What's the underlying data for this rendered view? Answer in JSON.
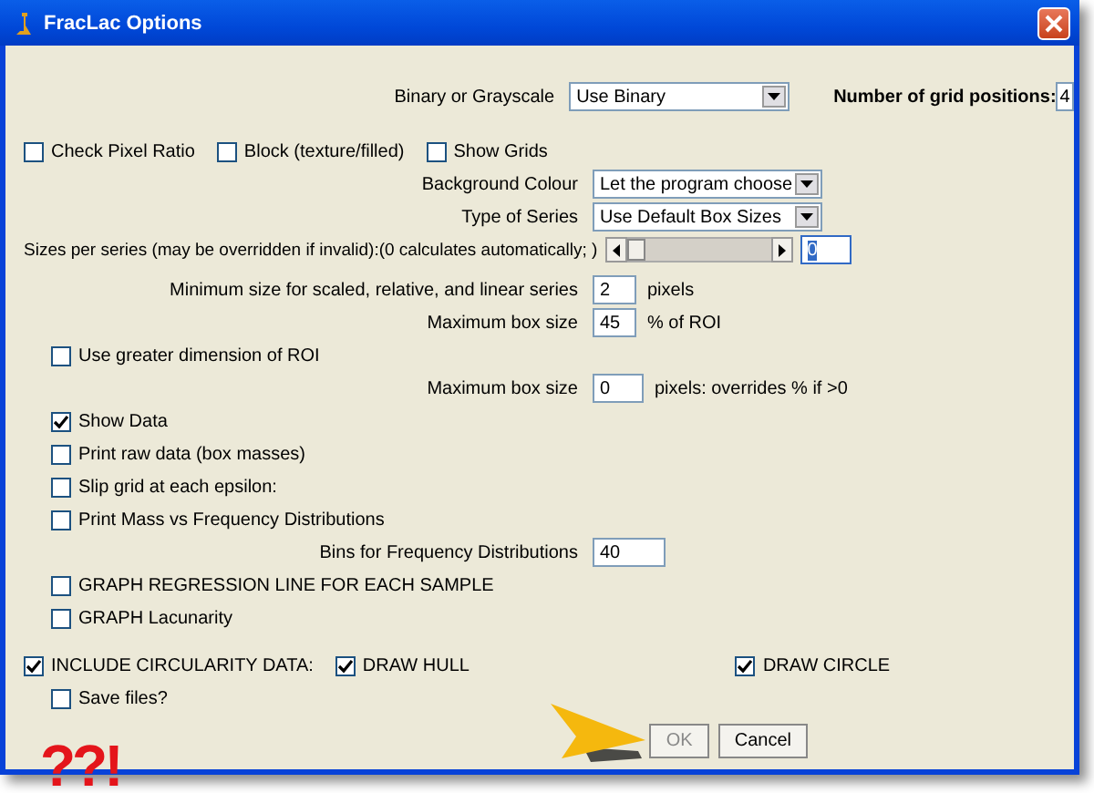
{
  "window": {
    "title": "FracLac Options"
  },
  "rows": [
    {
      "kind": "select",
      "label": "Binary or Grayscale",
      "value": "Use Binary",
      "extra_label": "Number of grid positions:",
      "extra_value": "4"
    },
    {
      "kind": "checks",
      "items": [
        {
          "label": "Check Pixel Ratio",
          "checked": false
        },
        {
          "label": "Block (texture/filled)",
          "checked": false
        },
        {
          "label": "Show Grids",
          "checked": false
        }
      ]
    },
    {
      "kind": "select",
      "label": "Background Colour",
      "value": "Let the program choose"
    },
    {
      "kind": "select",
      "label": "Type of Series",
      "value": "Use Default Box Sizes"
    },
    {
      "kind": "slider",
      "label": "Sizes per series (may be overridden if invalid):(0 calculates automatically; )",
      "level": 0,
      "value": "0"
    },
    {
      "kind": "number",
      "label": "Minimum size for scaled, relative, and linear series",
      "value": "2",
      "unit": "pixels"
    },
    {
      "kind": "number",
      "label": "Maximum box size",
      "value": "45",
      "unit": "% of ROI"
    },
    {
      "kind": "check",
      "label": "Use greater dimension of ROI",
      "checked": false
    },
    {
      "kind": "number",
      "label": "Maximum box size",
      "value": "0",
      "unit": "pixels: overrides % if >0"
    },
    {
      "kind": "check",
      "label": "Show Data",
      "checked": true
    },
    {
      "kind": "check",
      "label": "Print raw data (box masses)",
      "checked": false
    },
    {
      "kind": "check",
      "label": "Slip grid at each epsilon:",
      "checked": false
    },
    {
      "kind": "check",
      "label": "Print Mass vs Frequency Distributions",
      "checked": false
    },
    {
      "kind": "number",
      "label": "Bins for Frequency Distributions",
      "value": "40"
    },
    {
      "kind": "check",
      "label": "GRAPH REGRESSION LINE FOR EACH SAMPLE",
      "checked": false
    },
    {
      "kind": "check",
      "label": "GRAPH Lacunarity",
      "checked": false
    },
    {
      "kind": "checks",
      "items": [
        {
          "label": "INCLUDE CIRCULARITY DATA:",
          "checked": true
        },
        {
          "label": "DRAW HULL",
          "checked": true
        },
        {
          "label": "DRAW CIRCLE",
          "checked": true
        }
      ]
    },
    {
      "kind": "check",
      "label": "Save files?",
      "checked": false
    }
  ],
  "buttons": [
    "OK",
    "Cancel"
  ],
  "annotation": {
    "text": "??!"
  }
}
